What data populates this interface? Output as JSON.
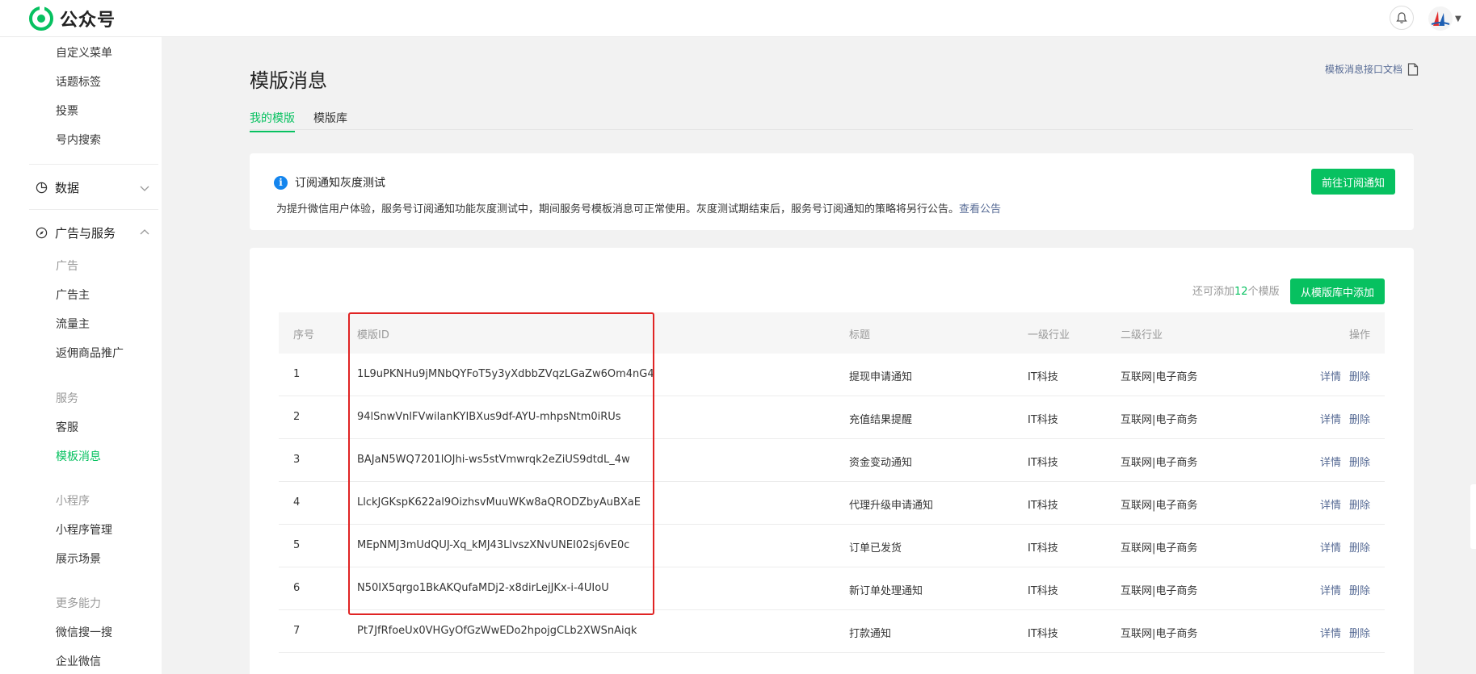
{
  "header": {
    "app_name": "公众号",
    "colors": {
      "brand": "#07c160",
      "link": "#576b95"
    }
  },
  "sidebar": {
    "items_top": [
      {
        "label": "自定义菜单"
      },
      {
        "label": "话题标签"
      },
      {
        "label": "投票"
      },
      {
        "label": "号内搜索"
      }
    ],
    "groups": {
      "data": {
        "label": "数据",
        "icon": "pie-chart-icon",
        "expanded": false
      },
      "ads": {
        "label": "广告与服务",
        "icon": "compass-icon",
        "expanded": true
      }
    },
    "ads_cat": "广告",
    "ads_items": [
      {
        "label": "广告主"
      },
      {
        "label": "流量主"
      },
      {
        "label": "返佣商品推广"
      }
    ],
    "service_cat": "服务",
    "service_items": [
      {
        "label": "客服"
      },
      {
        "label": "模板消息",
        "active": true
      }
    ],
    "mini_cat": "小程序",
    "mini_items": [
      {
        "label": "小程序管理"
      },
      {
        "label": "展示场景"
      }
    ],
    "more_cat": "更多能力",
    "more_items": [
      {
        "label": "微信搜一搜"
      },
      {
        "label": "企业微信"
      }
    ]
  },
  "main": {
    "title": "模版消息",
    "doc_link": "模板消息接口文档",
    "tabs": [
      {
        "label": "我的模版",
        "active": true
      },
      {
        "label": "模版库"
      }
    ],
    "notice": {
      "title": "订阅通知灰度测试",
      "text": "为提升微信用户体验，服务号订阅通知功能灰度测试中，期间服务号模板消息可正常使用。灰度测试期结束后，服务号订阅通知的策略将另行公告。",
      "link": "查看公告",
      "button": "前往订阅通知"
    },
    "quota": {
      "prefix": "还可添加",
      "count": "12",
      "suffix": "个模版"
    },
    "add_button": "从模版库中添加",
    "table": {
      "headers": {
        "index": "序号",
        "id": "模版ID",
        "title": "标题",
        "industry1": "一级行业",
        "industry2": "二级行业",
        "ops": "操作"
      },
      "detail_label": "详情",
      "delete_label": "删除",
      "rows": [
        {
          "index": "1",
          "id": "1L9uPKNHu9jMNbQYFoT5y3yXdbbZVqzLGaZw6Om4nG4",
          "title": "提现申请通知",
          "industry1": "IT科技",
          "industry2": "互联网|电子商务"
        },
        {
          "index": "2",
          "id": "94lSnwVnlFVwilanKYIBXus9df-AYU-mhpsNtm0iRUs",
          "title": "充值结果提醒",
          "industry1": "IT科技",
          "industry2": "互联网|电子商务"
        },
        {
          "index": "3",
          "id": "BAJaN5WQ7201lOJhi-ws5stVmwrqk2eZiUS9dtdL_4w",
          "title": "资金变动通知",
          "industry1": "IT科技",
          "industry2": "互联网|电子商务"
        },
        {
          "index": "4",
          "id": "LlckJGKspK622al9OizhsvMuuWKw8aQRODZbyAuBXaE",
          "title": "代理升级申请通知",
          "industry1": "IT科技",
          "industry2": "互联网|电子商务"
        },
        {
          "index": "5",
          "id": "MEpNMJ3mUdQUJ-Xq_kMJ43LlvszXNvUNEI02sj6vE0c",
          "title": "订单已发货",
          "industry1": "IT科技",
          "industry2": "互联网|电子商务"
        },
        {
          "index": "6",
          "id": "N50IX5qrgo1BkAKQufaMDj2-x8dirLejJKx-i-4UIoU",
          "title": "新订单处理通知",
          "industry1": "IT科技",
          "industry2": "互联网|电子商务"
        },
        {
          "index": "7",
          "id": "Pt7JfRfoeUx0VHGyOfGzWwEDo2hpojgCLb2XWSnAiqk",
          "title": "打款通知",
          "industry1": "IT科技",
          "industry2": "互联网|电子商务"
        }
      ]
    }
  }
}
